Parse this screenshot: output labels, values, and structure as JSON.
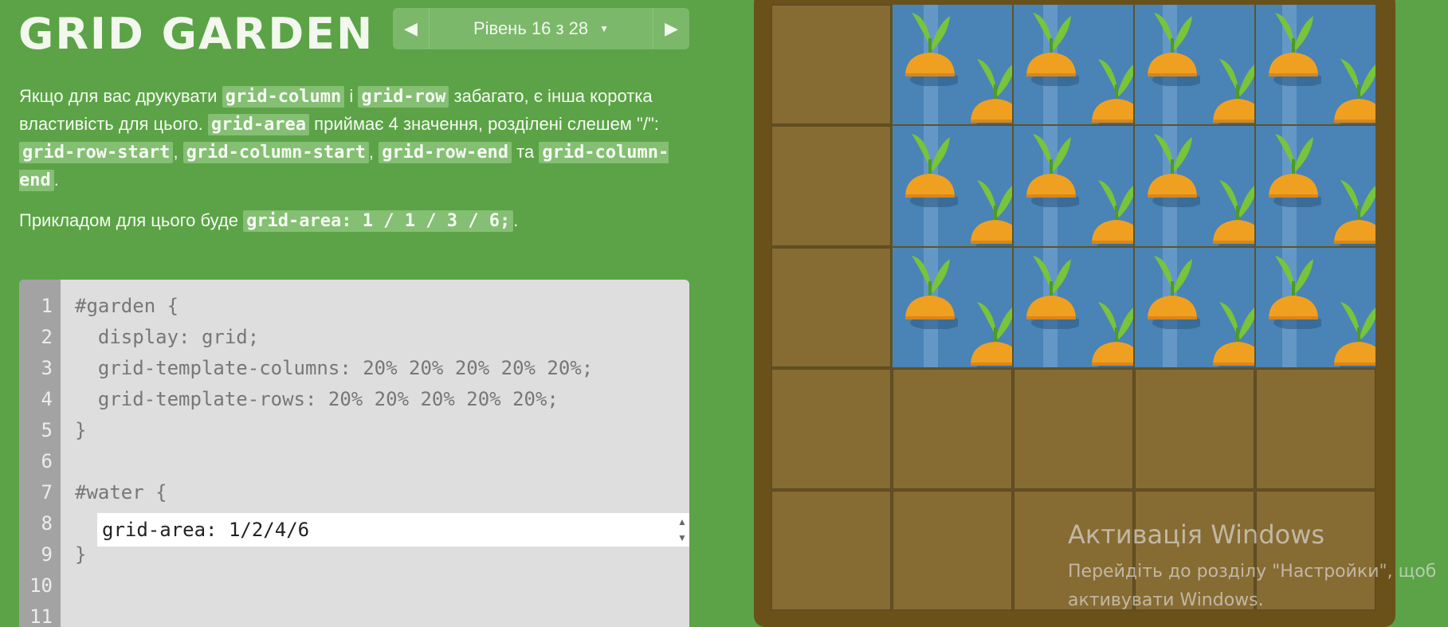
{
  "app": {
    "title": "GRID GARDEN"
  },
  "level_nav": {
    "label": "Рівень 16 з 28",
    "prev_icon": "triangle-left-icon",
    "next_icon": "triangle-right-icon"
  },
  "description": {
    "p1": {
      "t1": "Якщо для вас друкувати ",
      "c1": "grid-column",
      "t2": " і ",
      "c2": "grid-row",
      "t3": " забагато, є інша коротка властивість для цього. ",
      "c3": "grid-area",
      "t4": " приймає 4 значення, розділені слешем \"/\": ",
      "c4": "grid-row-start",
      "t5": ", ",
      "c5": "grid-column-start",
      "t6": ", ",
      "c6": "grid-row-end",
      "t7": " та ",
      "c7": "grid-column-end",
      "t8": "."
    },
    "p2": {
      "t1": "Прикладом для цього буде ",
      "c1": "grid-area: 1 / 1 / 3 / 6;",
      "t2": "."
    }
  },
  "editor": {
    "lines": [
      {
        "num": "1",
        "code": "#garden {"
      },
      {
        "num": "2",
        "code": "  display: grid;"
      },
      {
        "num": "3",
        "code": "  grid-template-columns: 20% 20% 20% 20% 20%;"
      },
      {
        "num": "4",
        "code": "  grid-template-rows: 20% 20% 20% 20% 20%;"
      },
      {
        "num": "5",
        "code": "}"
      },
      {
        "num": "6",
        "code": ""
      },
      {
        "num": "7",
        "code": "#water {"
      },
      {
        "num": "8",
        "code": ""
      },
      {
        "num": "9",
        "code": "}"
      },
      {
        "num": "10",
        "code": ""
      },
      {
        "num": "11",
        "code": ""
      }
    ],
    "input_value": "grid-area: 1/2/4/6"
  },
  "watermark": {
    "heading": "Активація Windows",
    "line1": "Перейдіть до розділу \"Настройки\", щоб",
    "line2": "активувати Windows."
  },
  "colors": {
    "background": "#5ba346",
    "soil": "#866b33",
    "frame": "#6a5019",
    "water": "#4a83b6",
    "carrot": "#f0a020",
    "leaf": "#78c43a"
  }
}
